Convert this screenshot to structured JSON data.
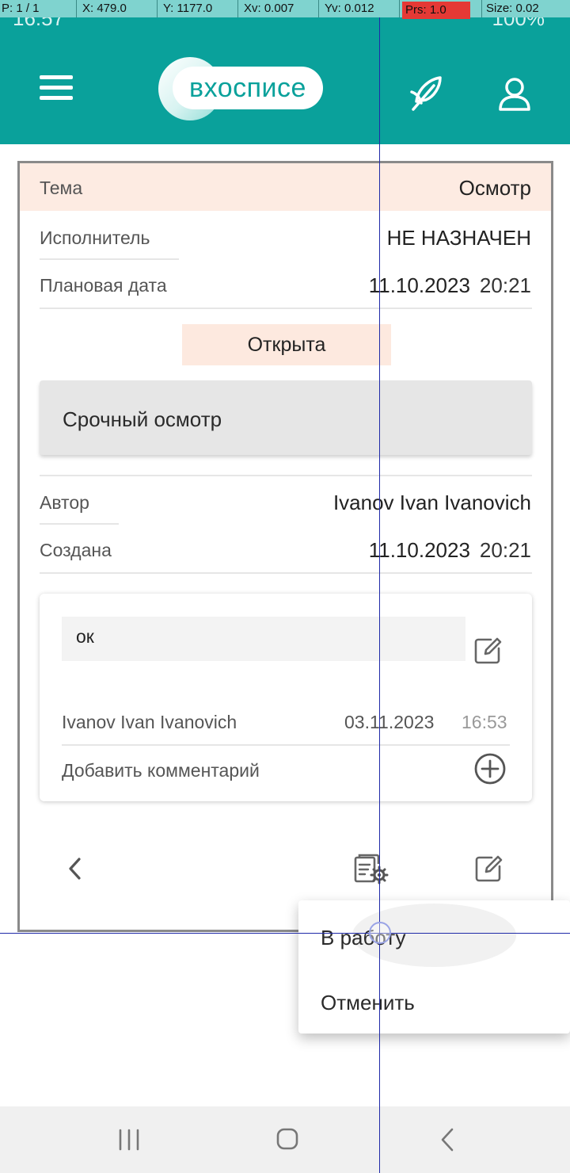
{
  "debug": {
    "pointer": "P: 1 / 1",
    "x": "X: 479.0",
    "y": "Y: 1177.0",
    "xv": "Xv: 0.007",
    "yv": "Yv: 0.012",
    "prs": "Prs: 1.0",
    "size": "Size: 0.02"
  },
  "status_bar": {
    "time": "16:57",
    "battery": "100%"
  },
  "app_bar": {
    "logo_text": "вхосписе",
    "menu_icon": "hamburger-menu-icon",
    "feather_icon": "feather-icon",
    "profile_icon": "person-icon"
  },
  "task": {
    "topic_label": "Тема",
    "topic_value": "Осмотр",
    "assignee_label": "Исполнитель",
    "assignee_value": "НЕ НАЗНАЧЕН",
    "planned_label": "Плановая дата",
    "planned_date": "11.10.2023",
    "planned_time": "20:21",
    "status": "Открыта",
    "description": "Срочный осмотр",
    "author_label": "Автор",
    "author_value": "Ivanov Ivan Ivanovich",
    "created_label": "Создана",
    "created_date": "11.10.2023",
    "created_time": "20:21"
  },
  "comment": {
    "text": "ок",
    "author": "Ivanov Ivan Ivanovich",
    "date": "03.11.2023",
    "time": "16:53",
    "add_label": "Добавить комментарий"
  },
  "popup_menu": {
    "items": [
      "В работу",
      "Отменить"
    ]
  },
  "colors": {
    "brand": "#0aa19b",
    "highlight": "#fdebe2",
    "status_chip": "#fde9df"
  }
}
